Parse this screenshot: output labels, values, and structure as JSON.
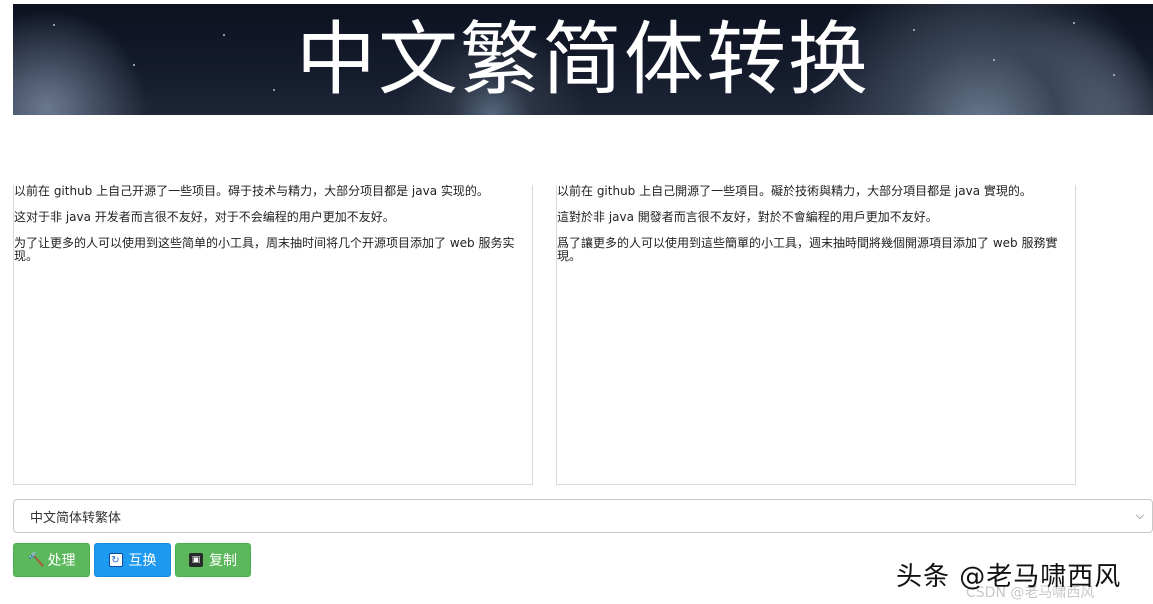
{
  "banner": {
    "title": "中文繁简体转换"
  },
  "left_panel": {
    "paragraphs": [
      "以前在 github 上自己开源了一些项目。碍于技术与精力，大部分项目都是 java 实现的。",
      "这对于非 java 开发者而言很不友好，对于不会编程的用户更加不友好。",
      "为了让更多的人可以使用到这些简单的小工具，周末抽时间将几个开源项目添加了 web 服务实现。"
    ]
  },
  "right_panel": {
    "paragraphs": [
      "以前在 github 上自己開源了一些項目。礙於技術與精力，大部分項目都是 java 實現的。",
      "這對於非 java 開發者而言很不友好，對於不會編程的用戶更加不友好。",
      "爲了讓更多的人可以使用到這些簡單的小工具，週末抽時間將幾個開源項目添加了 web 服務實現。"
    ]
  },
  "mode_select": {
    "selected": "中文简体转繁体"
  },
  "buttons": {
    "process": {
      "label": "处理",
      "icon": "hammer-icon"
    },
    "swap": {
      "label": "互换",
      "icon": "refresh-icon"
    },
    "copy": {
      "label": "复制",
      "icon": "save-icon"
    }
  },
  "watermark": {
    "main": "头条 @老马啸西风",
    "sub": "CSDN @老马啸西风"
  },
  "colors": {
    "green": "#5cb85c",
    "blue": "#1e9bf0"
  }
}
